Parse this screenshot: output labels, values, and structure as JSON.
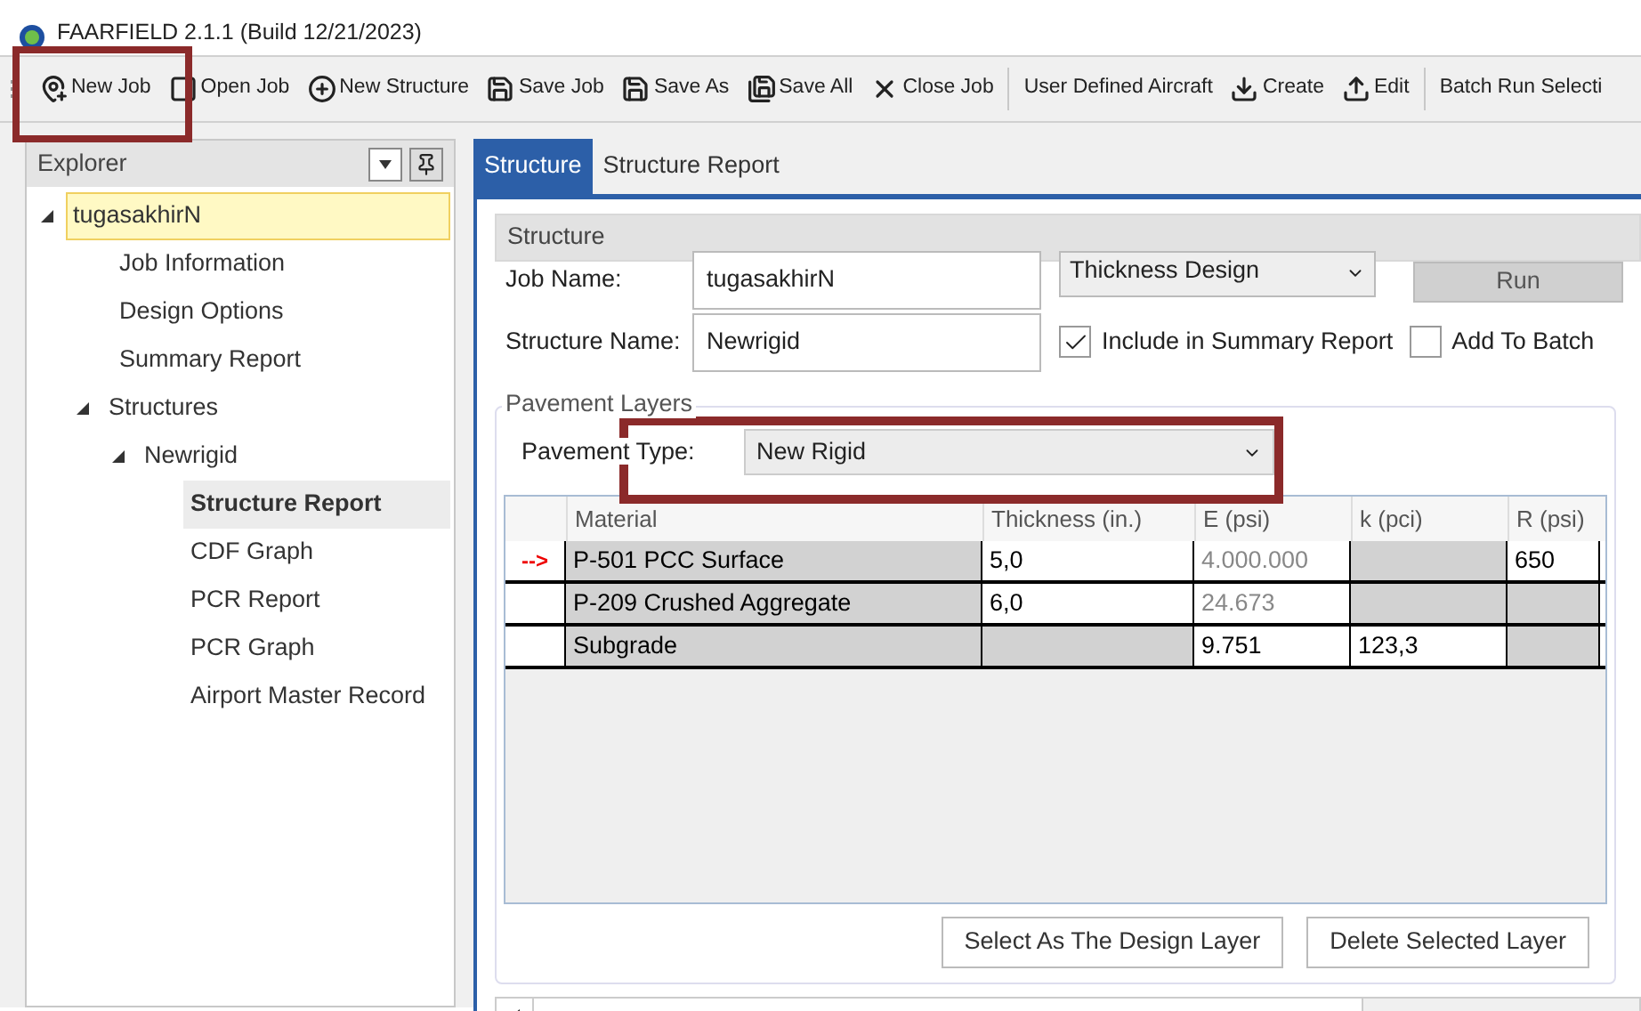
{
  "window": {
    "title": "FAARFIELD 2.1.1 (Build 12/21/2023)"
  },
  "toolbar_groups": [
    {
      "buttons": [
        {
          "label": "New Job"
        },
        {
          "label": "Open Job"
        },
        {
          "label": "New Structure"
        },
        {
          "label": "Save Job"
        },
        {
          "label": "Save As"
        },
        {
          "label": "Save All"
        },
        {
          "label": "Close Job"
        }
      ]
    },
    {
      "buttons": [
        {
          "label": "User Defined Aircraft"
        },
        {
          "label": "Create"
        },
        {
          "label": "Edit"
        }
      ]
    },
    {
      "buttons": [
        {
          "label": "Batch Run Selecti"
        }
      ]
    }
  ],
  "explorer": {
    "title": "Explorer",
    "items": [
      {
        "label": "tugasakhirN",
        "expanded": true,
        "selected": false,
        "highlighted": true,
        "children": [
          {
            "label": "Job Information",
            "selected": false,
            "highlighted": false
          },
          {
            "label": "Design Options",
            "selected": false,
            "highlighted": false
          },
          {
            "label": "Summary Report",
            "selected": false,
            "highlighted": false
          },
          {
            "label": "Structures",
            "expanded": true,
            "selected": false,
            "highlighted": false,
            "children": [
              {
                "label": "Newrigid",
                "expanded": true,
                "selected": false,
                "highlighted": false,
                "children": [
                  {
                    "label": "Structure Report",
                    "selected": true,
                    "highlighted": false
                  },
                  {
                    "label": "CDF Graph",
                    "selected": false,
                    "highlighted": false
                  },
                  {
                    "label": "PCR Report",
                    "selected": false,
                    "highlighted": false
                  },
                  {
                    "label": "PCR Graph",
                    "selected": false,
                    "highlighted": false
                  },
                  {
                    "label": "Airport Master Record",
                    "selected": false,
                    "highlighted": false
                  }
                ]
              }
            ]
          }
        ]
      }
    ]
  },
  "tabs": [
    {
      "label": "Structure",
      "selected": true
    },
    {
      "label": "Structure Report",
      "selected": false
    }
  ],
  "structure": {
    "header": "Structure",
    "job_name": {
      "label": "Job Name:",
      "value": "tugasakhirN"
    },
    "structure_name": {
      "label": "Structure Name:",
      "value": "Newrigid"
    },
    "mode": {
      "value": "Thickness Design"
    },
    "run_button": {
      "label": "Run",
      "disabled": true
    },
    "include_summary": {
      "label": "Include in Summary Report",
      "checked": true
    },
    "add_batch": {
      "label": "Add To Batch",
      "checked": false
    },
    "pavement_layers": {
      "title": "Pavement Layers",
      "pavement_type": {
        "label": "Pavement Type:",
        "value": "New Rigid"
      },
      "table": {
        "columns": [
          "Material",
          "Thickness (in.)",
          "E (psi)",
          "k (pci)",
          "R (psi)"
        ],
        "rows": [
          {
            "marker": "-->",
            "cells": [
              {
                "text": "P-501 PCC Surface",
                "editable": false
              },
              {
                "text": "5,0",
                "editable": true
              },
              {
                "text": "4.000.000",
                "editable": true,
                "dim": true
              },
              {
                "editable": false
              },
              {
                "text": "650",
                "editable": true
              }
            ]
          },
          {
            "cells": [
              {
                "text": "P-209 Crushed Aggregate",
                "editable": false
              },
              {
                "text": "6,0",
                "editable": true
              },
              {
                "text": "24.673",
                "editable": true,
                "dim": true
              },
              {
                "editable": false
              },
              {
                "editable": false
              }
            ]
          },
          {
            "cells": [
              {
                "text": "Subgrade",
                "editable": false
              },
              {
                "editable": false
              },
              {
                "text": "9.751",
                "editable": true
              },
              {
                "text": "123,3",
                "editable": true
              },
              {
                "editable": false
              }
            ]
          }
        ]
      },
      "buttons": [
        "Select As The Design Layer",
        "Delete Selected Layer"
      ]
    }
  }
}
